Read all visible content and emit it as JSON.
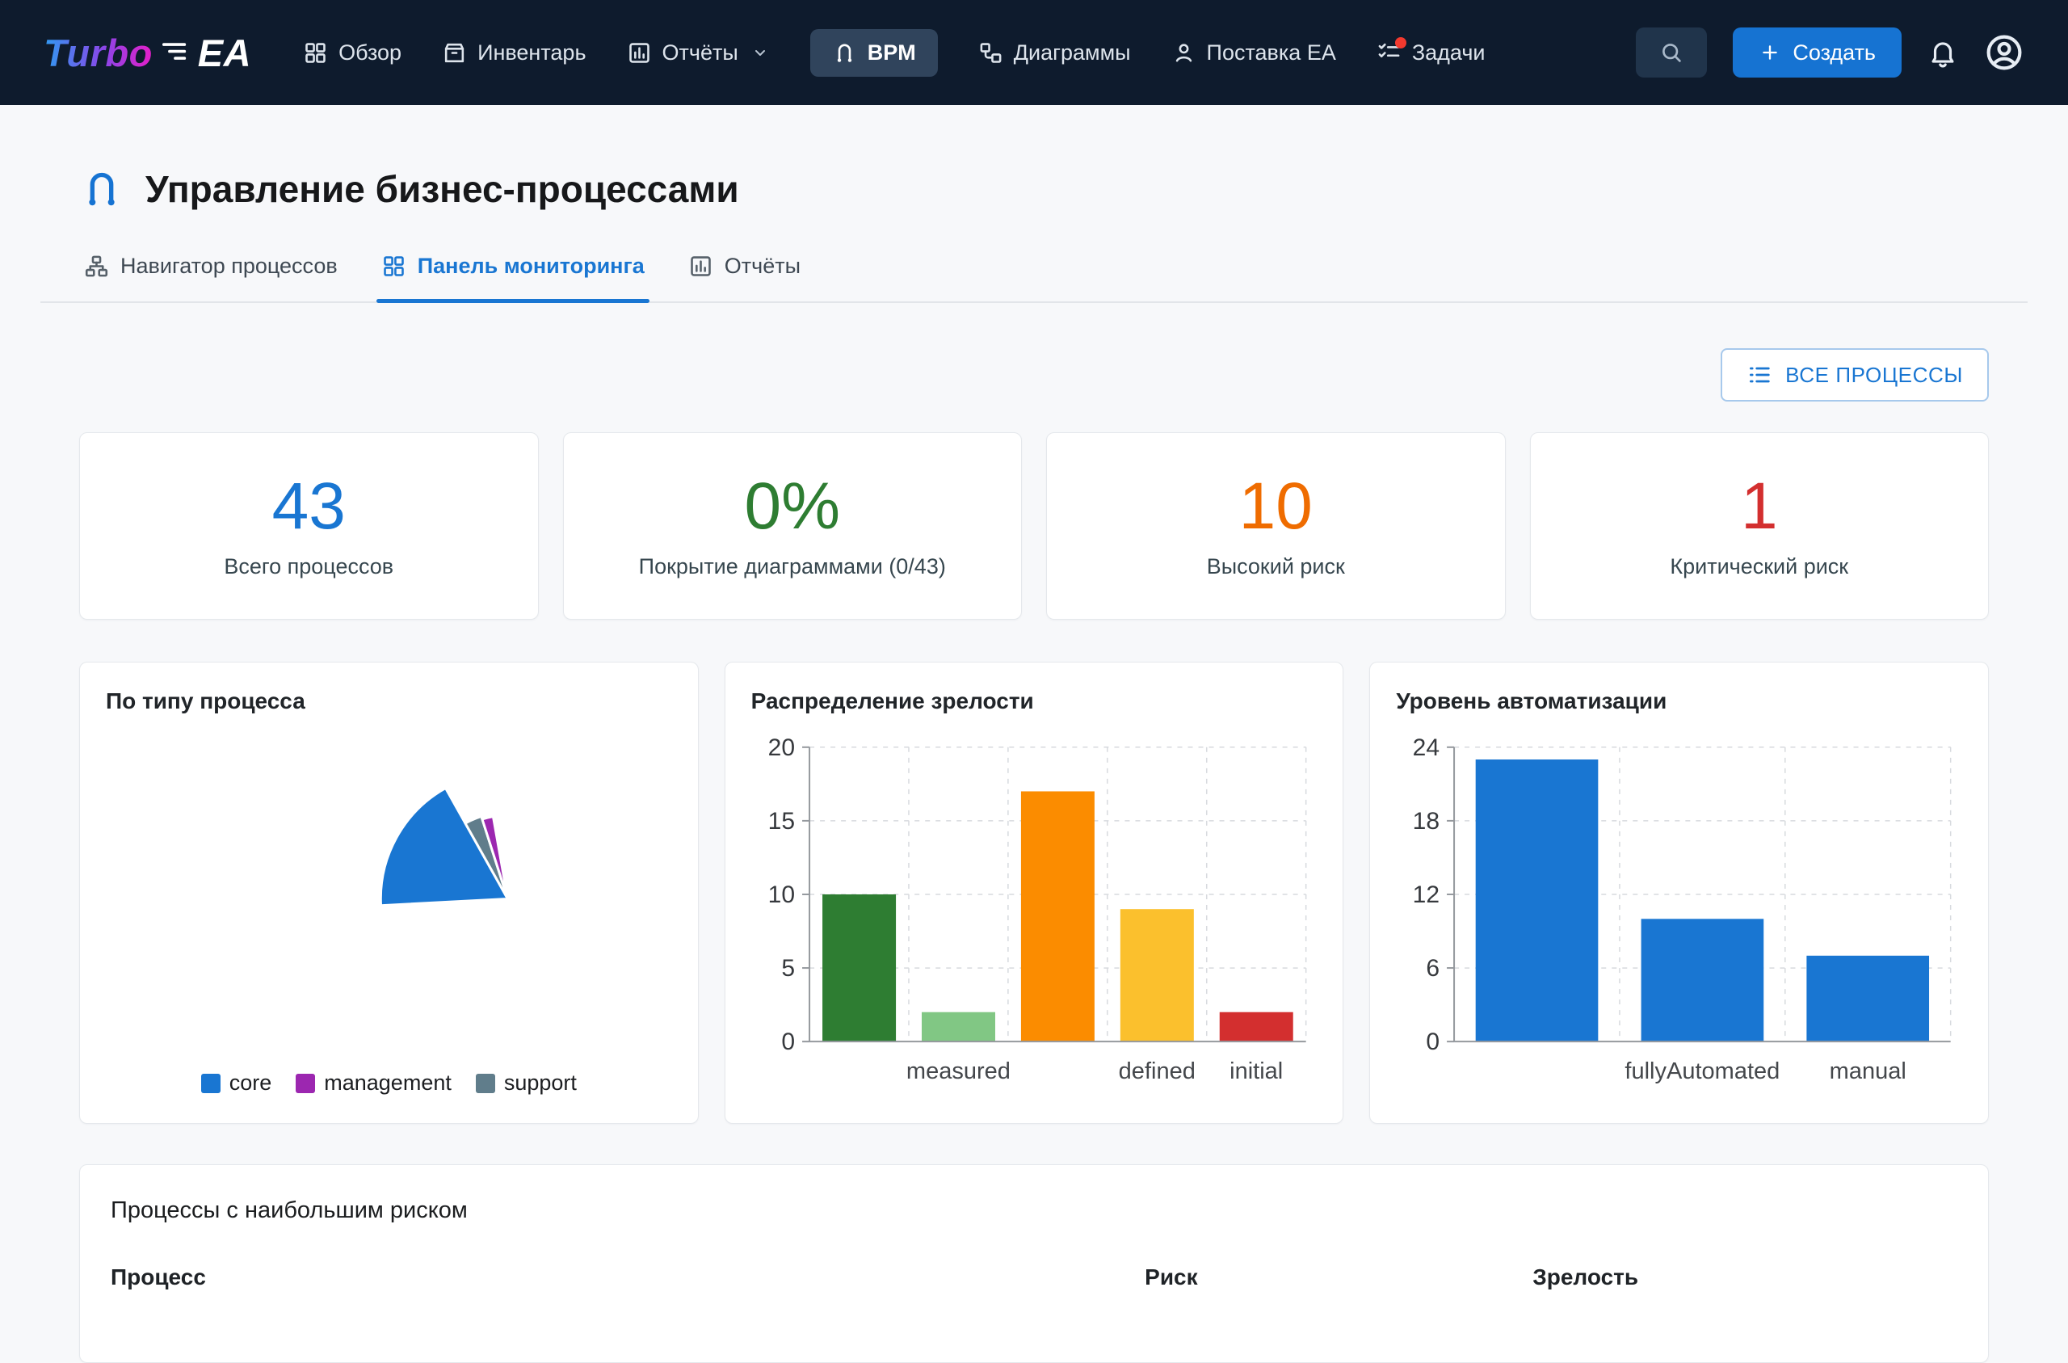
{
  "brand": {
    "name_primary": "Turbo",
    "name_secondary": "EA"
  },
  "nav": {
    "items": [
      {
        "label": "Обзор",
        "icon": "grid"
      },
      {
        "label": "Инвентарь",
        "icon": "box"
      },
      {
        "label": "Отчёты",
        "icon": "reports",
        "has_dropdown": true
      },
      {
        "label": "BPM",
        "icon": "bpm",
        "active": true
      },
      {
        "label": "Диаграммы",
        "icon": "diagram"
      },
      {
        "label": "Поставка EA",
        "icon": "person"
      },
      {
        "label": "Задачи",
        "icon": "tasks",
        "notification": true
      }
    ],
    "create_label": "Создать"
  },
  "page": {
    "title": "Управление бизнес-процессами",
    "tabs": [
      {
        "label": "Навигатор процессов",
        "icon": "sitemap"
      },
      {
        "label": "Панель мониторинга",
        "icon": "grid",
        "active": true
      },
      {
        "label": "Отчёты",
        "icon": "reports"
      }
    ],
    "all_processes_label": "ВСЕ ПРОЦЕССЫ"
  },
  "kpis": [
    {
      "value": "43",
      "label": "Всего процессов",
      "color": "#1976d2"
    },
    {
      "value": "0%",
      "label": "Покрытие диаграммами (0/43)",
      "color": "#2e7d32"
    },
    {
      "value": "10",
      "label": "Высокий риск",
      "color": "#ef6c00"
    },
    {
      "value": "1",
      "label": "Критический риск",
      "color": "#d32f2f"
    }
  ],
  "chart_data": [
    {
      "type": "pie",
      "title": "По типу процесса",
      "slices": [
        {
          "label": "core",
          "value": 33,
          "color": "#1976d2"
        },
        {
          "label": "management",
          "value": 4,
          "color": "#9c27b0"
        },
        {
          "label": "support",
          "value": 6,
          "color": "#607d8b"
        }
      ],
      "legend_position": "bottom"
    },
    {
      "type": "bar",
      "title": "Распределение зрелости",
      "categories": [
        "",
        "measured",
        "",
        "defined",
        "initial"
      ],
      "values": [
        10,
        2,
        17,
        9,
        2
      ],
      "colors": [
        "#2e7d32",
        "#81c784",
        "#fb8c00",
        "#fbc02d",
        "#d32f2f"
      ],
      "ylim": [
        0,
        20
      ],
      "yticks": [
        0,
        5,
        10,
        15,
        20
      ],
      "grid": "dashed"
    },
    {
      "type": "bar",
      "title": "Уровень автоматизации",
      "categories": [
        "",
        "fullyAutomated",
        "manual"
      ],
      "values": [
        23,
        10,
        7
      ],
      "colors": [
        "#1976d2",
        "#1976d2",
        "#1976d2"
      ],
      "ylim": [
        0,
        24
      ],
      "yticks": [
        0,
        6,
        12,
        18,
        24
      ],
      "grid": "dashed"
    }
  ],
  "table": {
    "title": "Процессы с наибольшим риском",
    "columns": [
      "Процесс",
      "Риск",
      "Зрелость"
    ]
  }
}
